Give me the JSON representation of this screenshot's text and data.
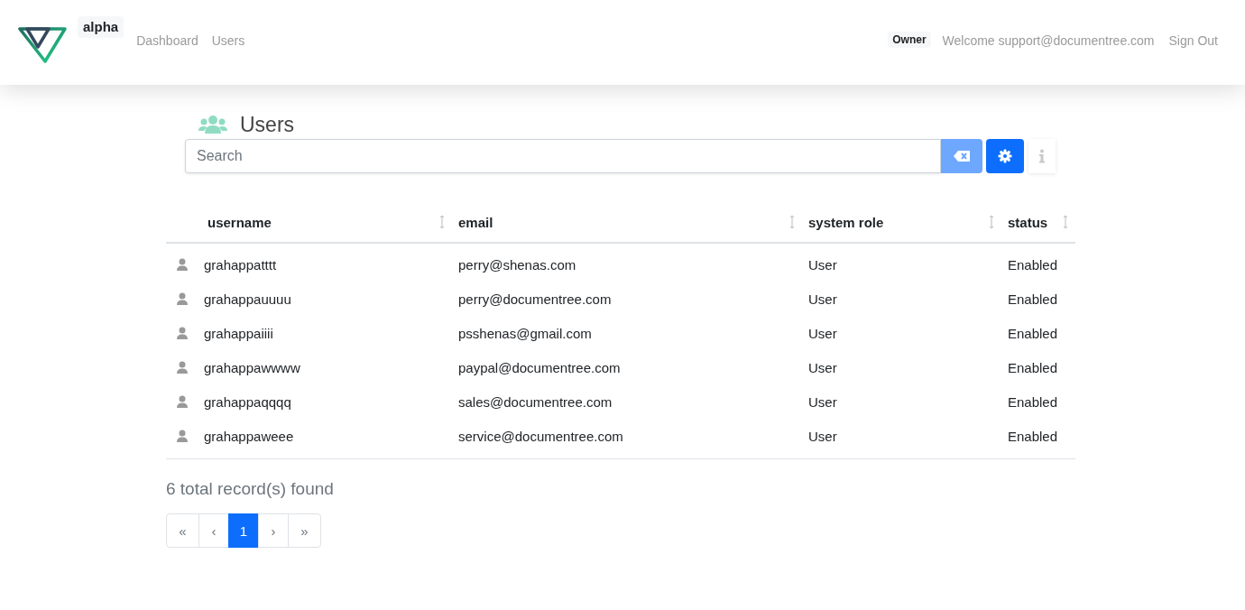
{
  "header": {
    "brand": "alpha",
    "nav": [
      {
        "label": "Dashboard"
      },
      {
        "label": "Users"
      }
    ],
    "role_badge": "Owner",
    "welcome": "Welcome support@documentree.com",
    "sign_out": "Sign Out"
  },
  "page": {
    "title": "Users"
  },
  "search": {
    "placeholder": "Search"
  },
  "table": {
    "columns": [
      "username",
      "email",
      "system role",
      "status"
    ],
    "rows": [
      {
        "username": "grahappatttt",
        "email": "perry@shenas.com",
        "role": "User",
        "status": "Enabled"
      },
      {
        "username": "grahappauuuu",
        "email": "perry@documentree.com",
        "role": "User",
        "status": "Enabled"
      },
      {
        "username": "grahappaiiii",
        "email": "psshenas@gmail.com",
        "role": "User",
        "status": "Enabled"
      },
      {
        "username": "grahappawwww",
        "email": "paypal@documentree.com",
        "role": "User",
        "status": "Enabled"
      },
      {
        "username": "grahappaqqqq",
        "email": "sales@documentree.com",
        "role": "User",
        "status": "Enabled"
      },
      {
        "username": "grahappaweee",
        "email": "service@documentree.com",
        "role": "User",
        "status": "Enabled"
      }
    ]
  },
  "summary": "6 total record(s) found",
  "pagination": [
    {
      "label": "«",
      "selected": false
    },
    {
      "label": "‹",
      "selected": false
    },
    {
      "label": "1",
      "selected": true
    },
    {
      "label": "›",
      "selected": false
    },
    {
      "label": "»",
      "selected": false
    }
  ]
}
